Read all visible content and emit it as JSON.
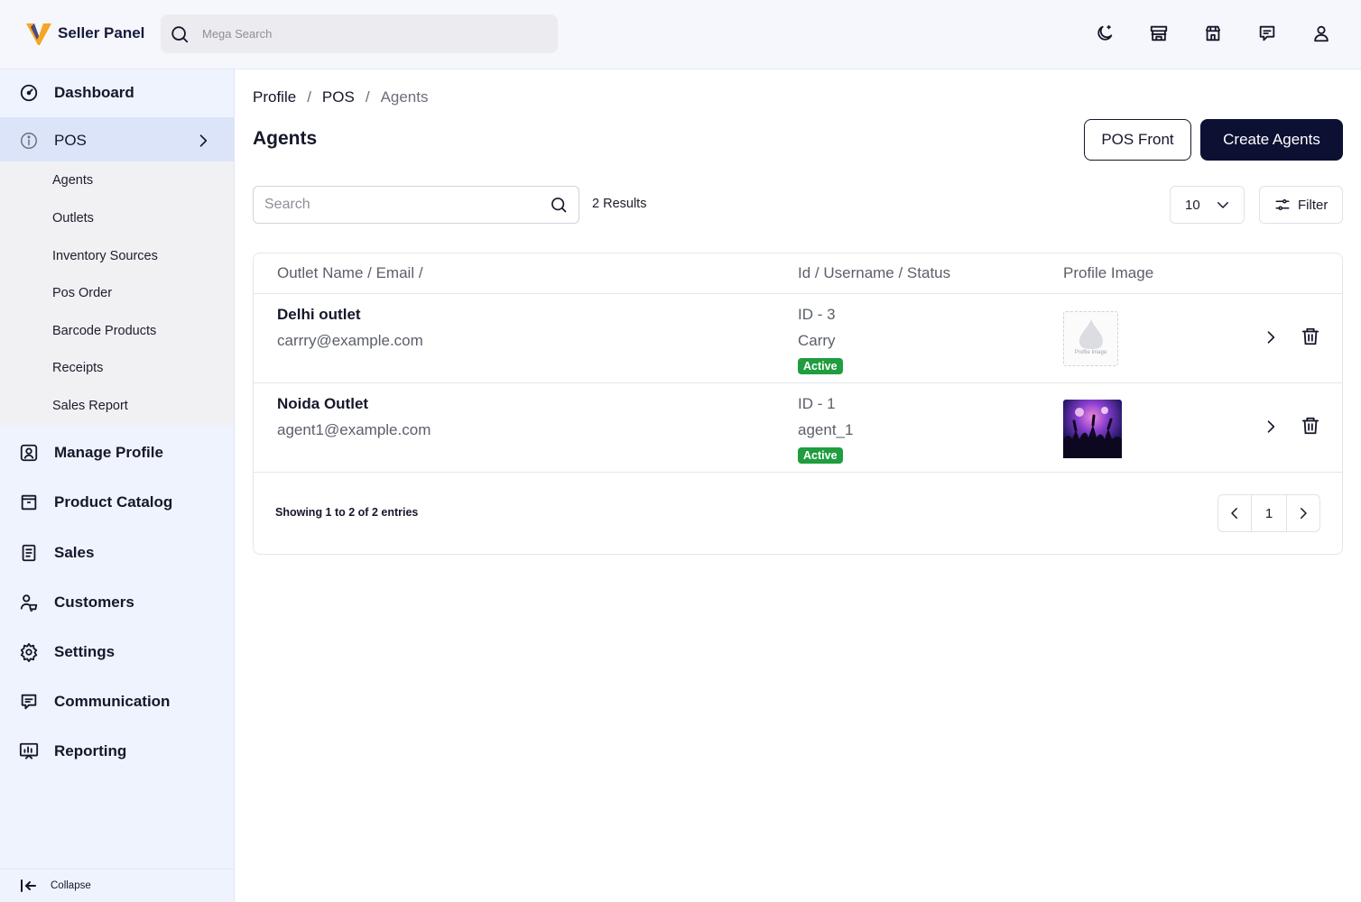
{
  "app": {
    "title": "Seller Panel"
  },
  "header": {
    "search_placeholder": "Mega Search",
    "icons": [
      "theme-moon-icon",
      "store-icon",
      "shop-icon",
      "chat-icon",
      "user-icon"
    ]
  },
  "sidebar": {
    "items": [
      {
        "label": "Dashboard",
        "icon": "dashboard-gauge-icon"
      },
      {
        "label": "POS",
        "icon": "info-icon"
      },
      {
        "label": "Manage Profile",
        "icon": "profile-icon"
      },
      {
        "label": "Product Catalog",
        "icon": "catalog-icon"
      },
      {
        "label": "Sales",
        "icon": "sales-document-icon"
      },
      {
        "label": "Customers",
        "icon": "customers-icon"
      },
      {
        "label": "Settings",
        "icon": "gear-icon"
      },
      {
        "label": "Communication",
        "icon": "chat-icon"
      },
      {
        "label": "Reporting",
        "icon": "reporting-icon"
      }
    ],
    "pos_submenu": [
      "Agents",
      "Outlets",
      "Inventory Sources",
      "Pos Order",
      "Barcode Products",
      "Receipts",
      "Sales Report"
    ],
    "collapse_label": "Collapse"
  },
  "breadcrumb": {
    "items": [
      "Profile",
      "POS"
    ],
    "current": "Agents",
    "separator": "/"
  },
  "page": {
    "title": "Agents",
    "pos_front_label": "POS Front",
    "create_label": "Create Agents",
    "search_placeholder": "Search",
    "results": "2 Results",
    "per_page": "10",
    "filter_label": "Filter"
  },
  "table": {
    "headers": [
      "Outlet Name / Email /",
      "Id / Username / Status",
      "Profile Image"
    ],
    "rows": [
      {
        "name": "Delhi outlet",
        "email": "carrry@example.com",
        "id": "ID - 3",
        "username": "Carry",
        "status": "Active",
        "image": "placeholder"
      },
      {
        "name": "Noida Outlet",
        "email": "agent1@example.com",
        "id": "ID - 1",
        "username": "agent_1",
        "status": "Active",
        "image": "concert-photo"
      }
    ],
    "placeholder_caption": "Profile Image",
    "footer": "Showing 1 to 2 of 2 entries",
    "current_page": "1"
  },
  "colors": {
    "brand_dark": "#0c1033",
    "active_green": "#1f9d3f",
    "sidebar_bg": "#eff3fd",
    "sidebar_active": "#dbe4f9",
    "logo_yellow": "#f5a623"
  }
}
